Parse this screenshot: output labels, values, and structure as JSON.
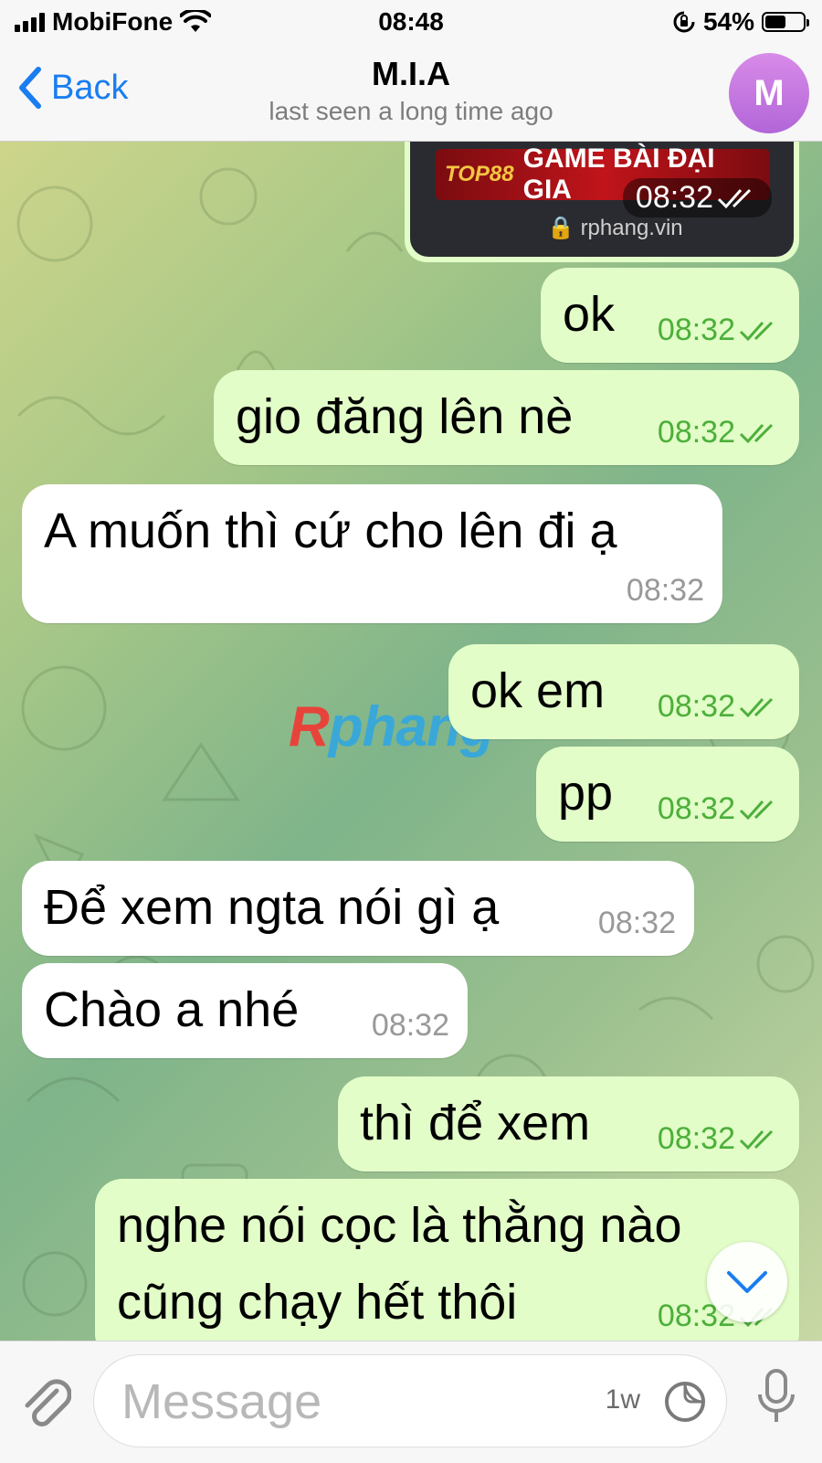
{
  "status_bar": {
    "carrier": "MobiFone",
    "time": "08:48",
    "battery": "54%",
    "battery_level": 0.54
  },
  "header": {
    "back_label": "Back",
    "title": "M.I.A",
    "subtitle": "last seen a long time ago",
    "avatar_initial": "M",
    "avatar_color": "#c07ae0"
  },
  "link_preview": {
    "banner_logo": "TOP88",
    "banner_text": "GAME BÀI ĐẠI GIA",
    "time": "08:32",
    "url": "rphang.vin"
  },
  "watermark": {
    "first": "R",
    "rest": "phang"
  },
  "messages": [
    {
      "dir": "out",
      "text": "ok",
      "time": "08:32"
    },
    {
      "dir": "out",
      "text": "gio đăng lên nè",
      "time": "08:32"
    },
    {
      "dir": "in",
      "text": "A muốn thì cứ cho lên đi ạ",
      "time": "08:32"
    },
    {
      "dir": "out",
      "text": "ok em",
      "time": "08:32"
    },
    {
      "dir": "out",
      "text": "pp",
      "time": "08:32"
    },
    {
      "dir": "in",
      "text": "Để xem ngta nói gì ạ",
      "time": "08:32"
    },
    {
      "dir": "in",
      "text": "Chào a nhé",
      "time": "08:32"
    },
    {
      "dir": "out",
      "text": "thì để xem",
      "time": "08:32"
    },
    {
      "dir": "out",
      "text_line1": "nghe nói cọc là thằng nào",
      "text_line2": "cũng chạy hết thôi",
      "time": "08:32"
    }
  ],
  "composer": {
    "placeholder": "Message",
    "timer": "1w"
  },
  "colors": {
    "accent": "#1a7df0",
    "outgoing_bubble": "#e2fdc8",
    "incoming_bubble": "#ffffff",
    "read_ticks": "#4caf3a"
  },
  "icons": [
    "signal-icon",
    "wifi-icon",
    "rotation-lock-icon",
    "battery-icon",
    "back-chevron-icon",
    "double-check-icon",
    "chevron-down-icon",
    "paperclip-icon",
    "sticker-icon",
    "microphone-icon"
  ]
}
